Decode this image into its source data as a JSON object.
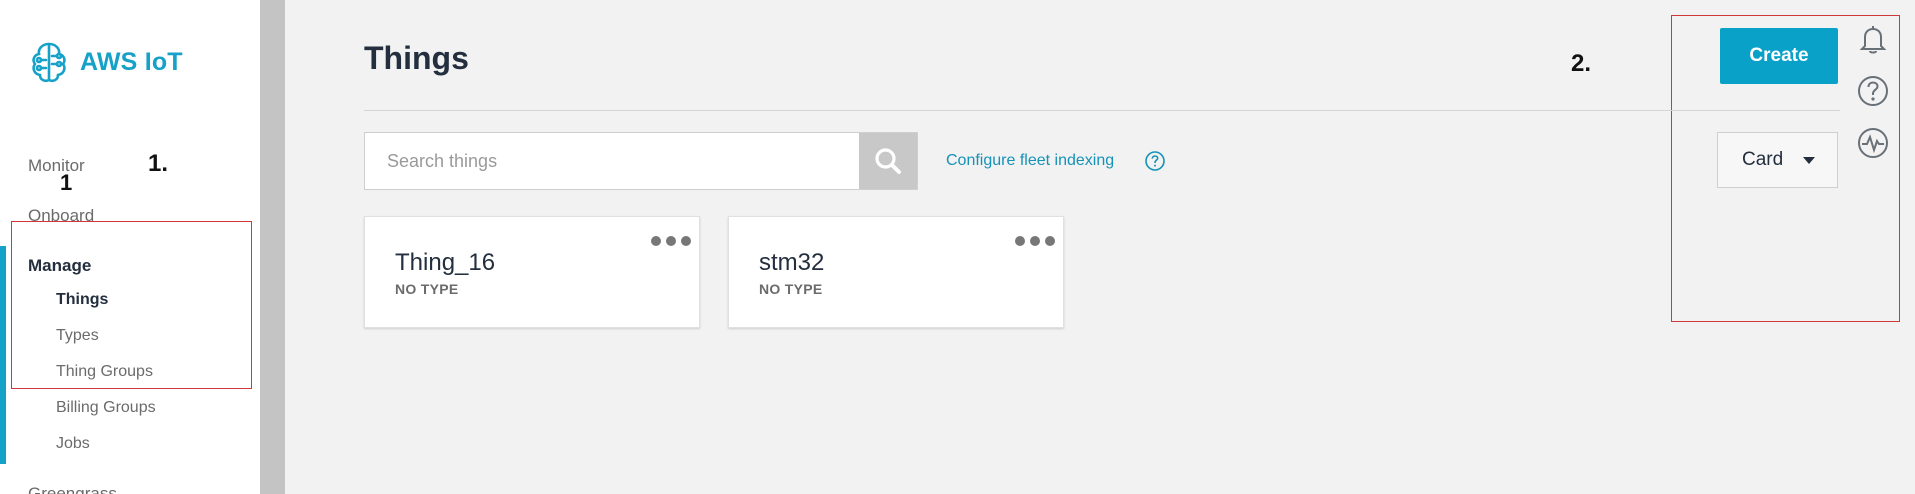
{
  "brand": {
    "name": "AWS IoT",
    "logo_icon": "iot-chip-icon",
    "color": "#16a1c8"
  },
  "sidebar": {
    "items": [
      {
        "label": "Monitor"
      },
      {
        "label": "Onboard"
      }
    ],
    "section": "Manage",
    "sub_items": [
      {
        "label": "Things",
        "active": true
      },
      {
        "label": "Types"
      },
      {
        "label": "Thing Groups"
      },
      {
        "label": "Billing Groups"
      },
      {
        "label": "Jobs"
      }
    ],
    "truncated_next": "Greengrass"
  },
  "annotations": {
    "label_1": "1.",
    "label_1b": "1",
    "label_2": "2.",
    "color": "#d0393a"
  },
  "page": {
    "title": "Things",
    "create_label": "Create",
    "search_placeholder": "Search things",
    "fleet_link": "Configure fleet indexing",
    "view_mode": "Card"
  },
  "top_icons": [
    "bell-icon",
    "help-circle-icon",
    "activity-icon"
  ],
  "things": [
    {
      "name": "Thing_16",
      "type": "NO TYPE"
    },
    {
      "name": "stm32",
      "type": "NO TYPE"
    }
  ],
  "colors": {
    "accent": "#0aa1c8",
    "active_bar": "#16a1c8",
    "link": "#1592b7"
  }
}
